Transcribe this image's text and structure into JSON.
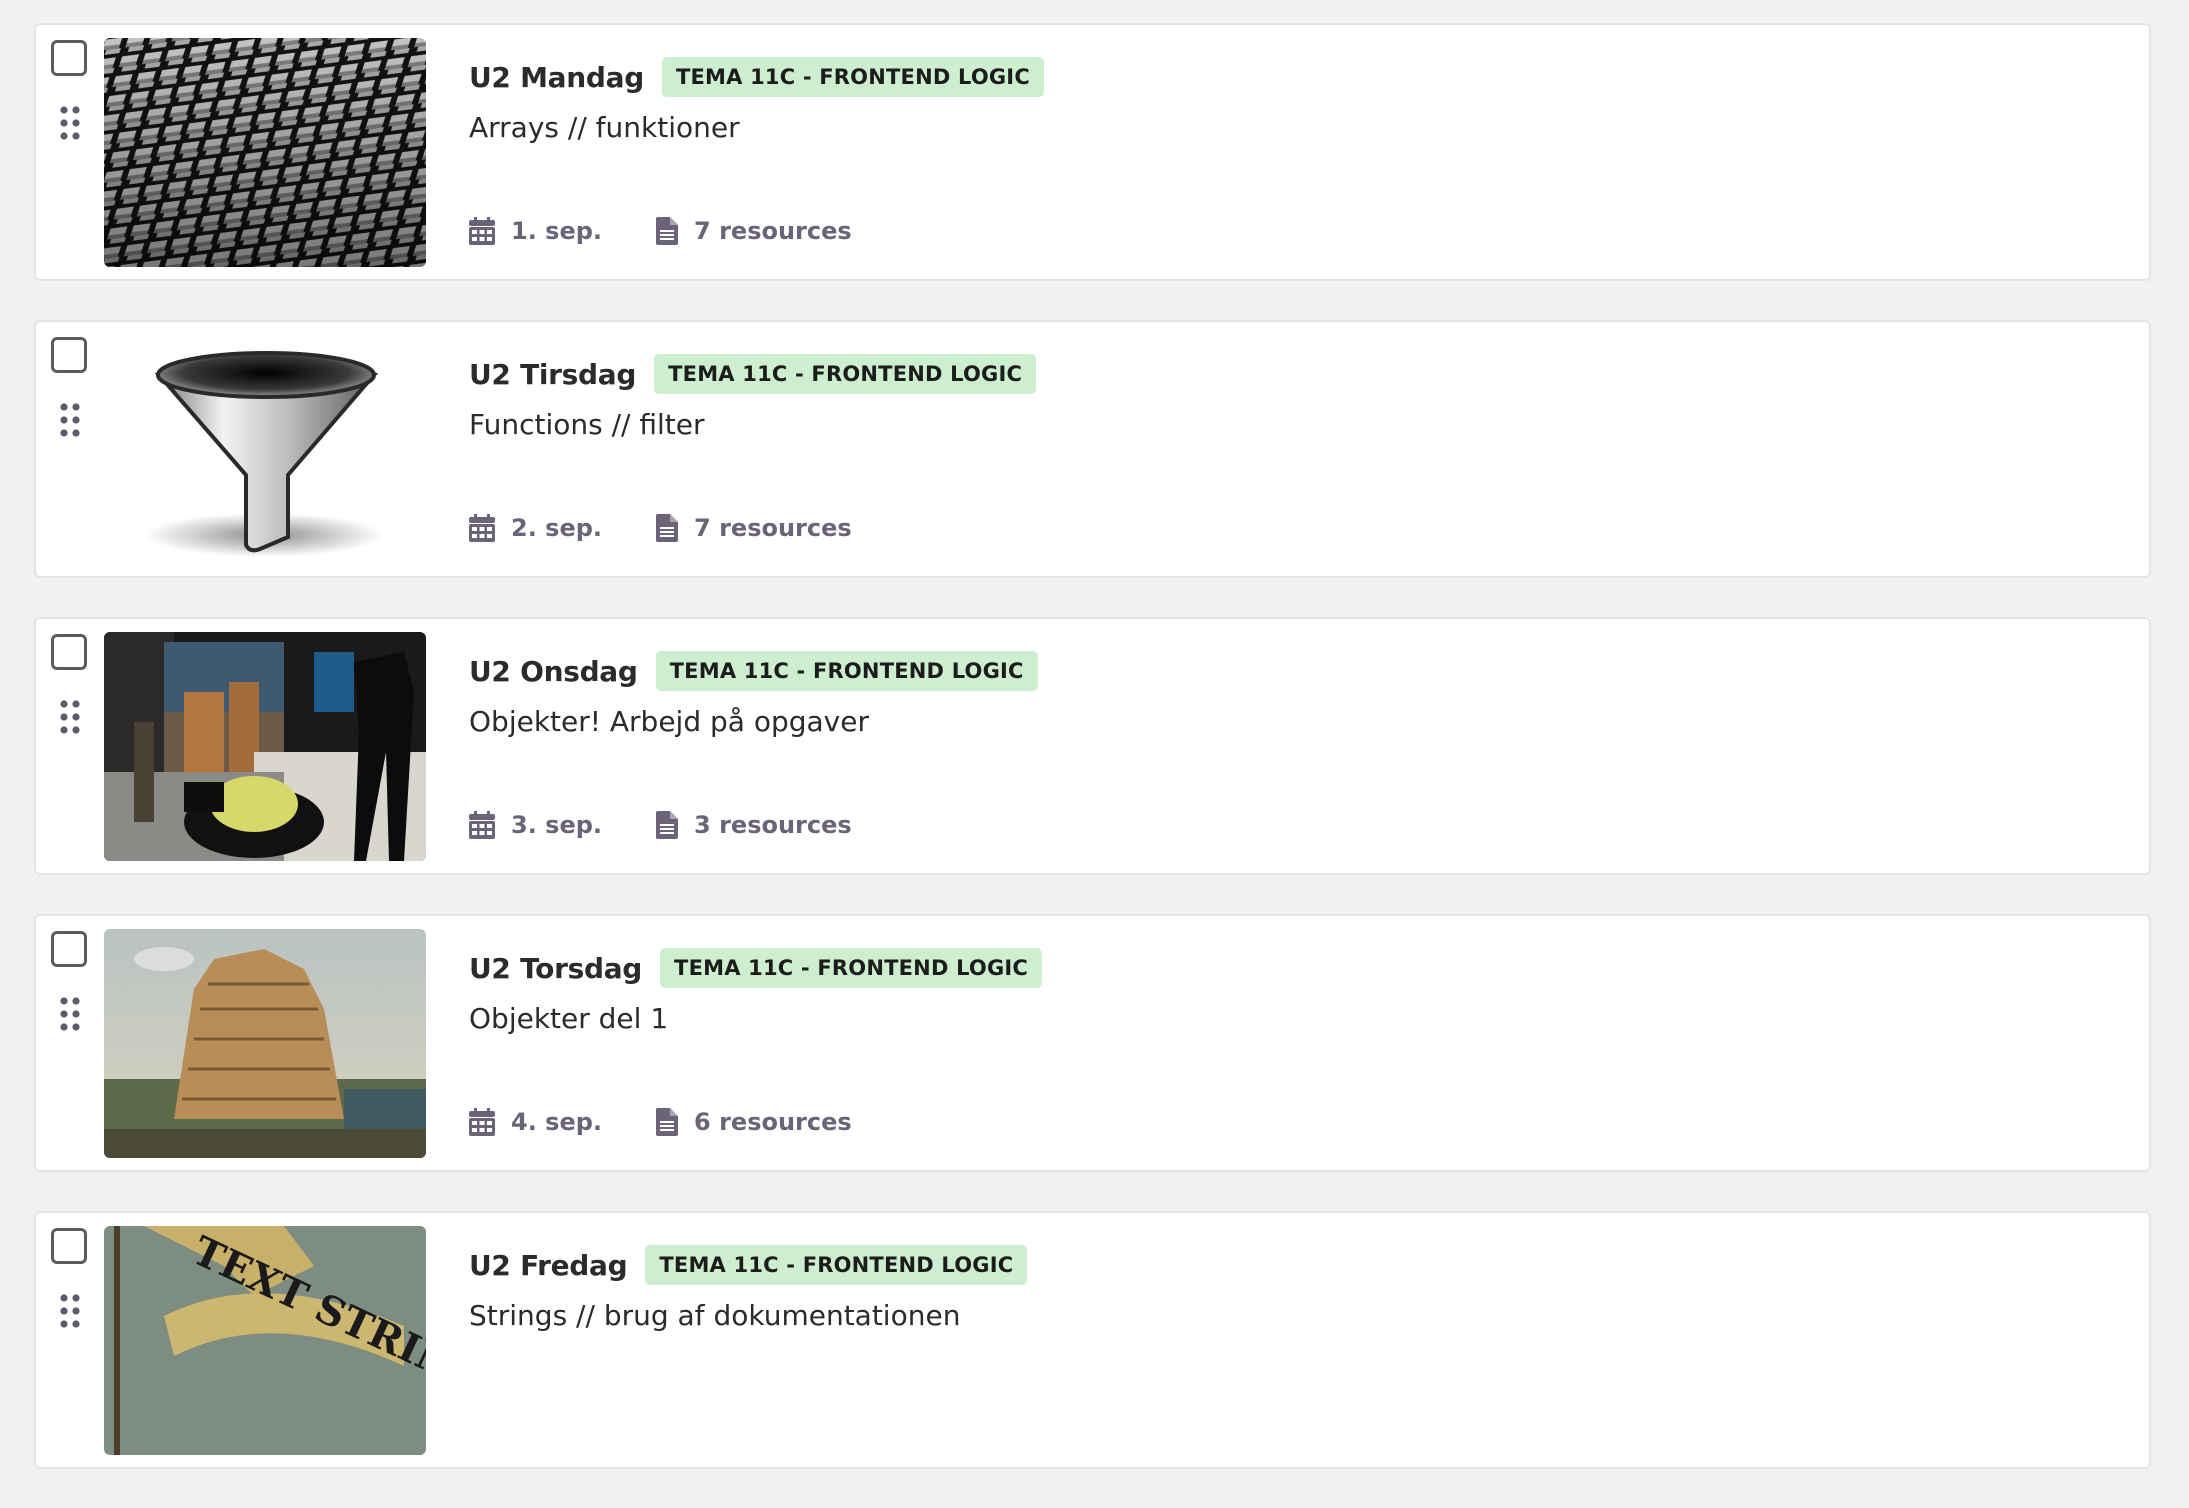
{
  "colors": {
    "page_bg": "#f1f1f1",
    "card_bg": "#ffffff",
    "tag_bg": "#cdeecf",
    "meta_text": "#6b6478",
    "icon": "#6b6478"
  },
  "lessons": [
    {
      "title": "U2 Mandag",
      "tag": "TEMA 11C - FRONTEND LOGIC",
      "subtitle": "Arrays  // funktioner",
      "date": "1. sep.",
      "resources": "7 resources",
      "image": "3d-blocks-pattern"
    },
    {
      "title": "U2 Tirsdag",
      "tag": "TEMA 11C - FRONTEND LOGIC",
      "subtitle": "Functions // filter",
      "date": "2. sep.",
      "resources": "7 resources",
      "image": "funnel"
    },
    {
      "title": "U2 Onsdag",
      "tag": "TEMA 11C - FRONTEND LOGIC",
      "subtitle": "Objekter! Arbejd på opgaver",
      "date": "3. sep.",
      "resources": "3 resources",
      "image": "museum-objects"
    },
    {
      "title": "U2 Torsdag",
      "tag": "TEMA 11C - FRONTEND LOGIC",
      "subtitle": "Objekter del 1",
      "date": "4. sep.",
      "resources": "6 resources",
      "image": "tower-of-babel"
    },
    {
      "title": "U2 Fredag",
      "tag": "TEMA 11C - FRONTEND LOGIC",
      "subtitle": "Strings // brug af dokumentationen",
      "date": "",
      "resources": "",
      "image": "text-string-banner",
      "image_text": "TEXT STRING"
    }
  ]
}
